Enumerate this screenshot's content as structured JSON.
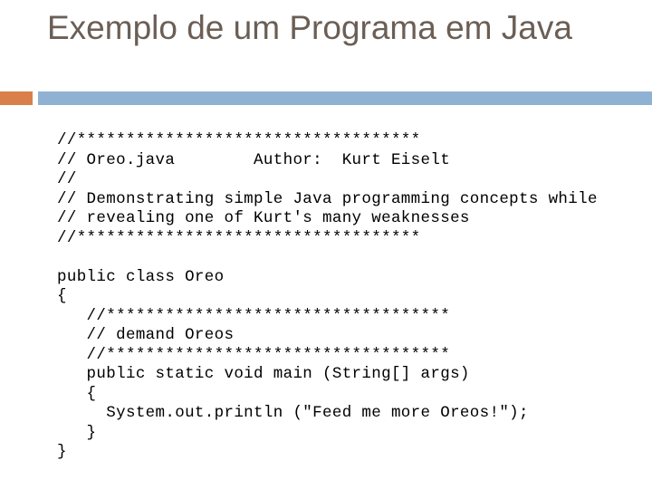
{
  "slide": {
    "title": "Exemplo de um Programa em Java",
    "colors": {
      "title_text": "#6B5E55",
      "accent_block": "#D9804A",
      "divider_bar": "#8FB2D3",
      "code_text": "#000000",
      "background": "#FFFFFF"
    }
  },
  "code": {
    "language": "java",
    "lines": [
      "//***********************************",
      "// Oreo.java        Author:  Kurt Eiselt",
      "//",
      "// Demonstrating simple Java programming concepts while",
      "// revealing one of Kurt's many weaknesses",
      "//***********************************",
      "",
      "public class Oreo",
      "{",
      "   //***********************************",
      "   // demand Oreos",
      "   //***********************************",
      "   public static void main (String[] args)",
      "   {",
      "     System.out.println (\"Feed me more Oreos!\");",
      "   }",
      "}"
    ]
  }
}
